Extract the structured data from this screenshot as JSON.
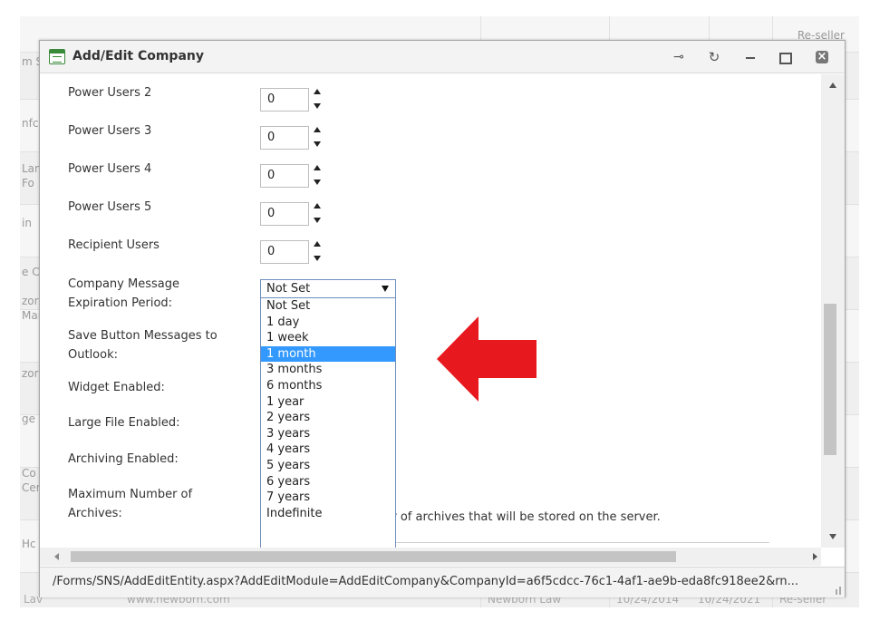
{
  "window": {
    "title": "Add/Edit Company",
    "pin_icon": "pin-icon",
    "refresh_icon": "refresh-icon",
    "minimize_icon": "minimize-icon",
    "maximize_icon": "maximize-icon",
    "close_icon": "close-icon"
  },
  "background": {
    "header_right": "Re-seller",
    "left_fragments": [
      "m S",
      "nfc",
      "Lan\nFo",
      "in",
      "e C",
      "zor\nMar",
      "zor",
      "ge l",
      "Co\nCer",
      "Hc"
    ],
    "bottom_fragments": [
      "Lav",
      "www.newborn.com",
      "Newborn Law",
      "10/24/2014",
      "10/24/2021",
      "Re-seller"
    ]
  },
  "form": {
    "fields": [
      {
        "label": "Power Users 2",
        "value": "0"
      },
      {
        "label": "Power Users 3",
        "value": "0"
      },
      {
        "label": "Power Users 4",
        "value": "0"
      },
      {
        "label": "Power Users 5",
        "value": "0"
      },
      {
        "label": "Recipient Users",
        "value": "0"
      }
    ],
    "company_message_label_1": "Company Message",
    "company_message_label_2": "Expiration Period:",
    "save_button_label_1": "Save Button Messages to",
    "save_button_label_2": "Outlook:",
    "widget_label": "Widget Enabled:",
    "large_file_label": "Large File Enabled:",
    "archiving_label": "Archiving Enabled:",
    "max_archives_label_1": "Maximum Number of",
    "max_archives_label_2": "Archives:",
    "max_archives_help": "The maximum number of archives that will be stored on the server."
  },
  "expiration_select": {
    "selected": "Not Set",
    "highlighted": "1 month",
    "options": [
      "Not Set",
      "1 day",
      "1 week",
      "1 month",
      "3 months",
      "6 months",
      "1 year",
      "2 years",
      "3 years",
      "4 years",
      "5 years",
      "6 years",
      "7 years",
      "Indefinite"
    ]
  },
  "annotation": {
    "arrow_icon": "arrow-left-icon",
    "color": "#e8191e"
  },
  "status_bar": {
    "url": "/Forms/SNS/AddEditEntity.aspx?AddEditModule=AddEditCompany&CompanyId=a6f5cdcc-76c1-4af1-ae9b-eda8fc918ee2&rn..."
  }
}
